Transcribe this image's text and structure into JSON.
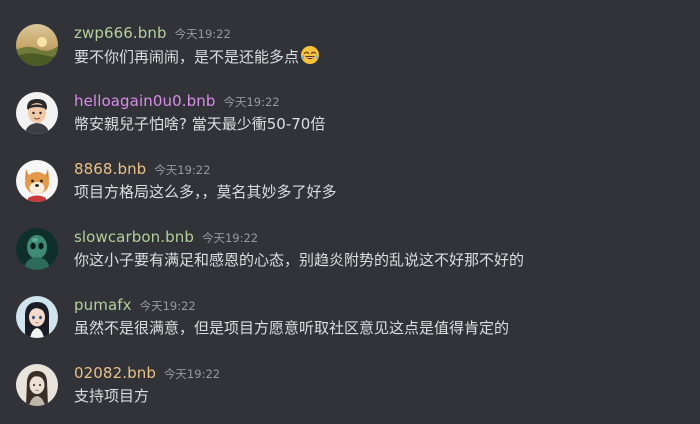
{
  "messages": [
    {
      "username": "zwp666.bnb",
      "name_color": "#b5cf9b",
      "timestamp": "今天19:22",
      "text": "要不你们再闹闹，是不是还能多点",
      "emoji": "face-with-tears-of-joy-icon",
      "avatar": "landscape-avatar"
    },
    {
      "username": "helloagain0u0.bnb",
      "name_color": "#d88ee8",
      "timestamp": "今天19:22",
      "text": "幣安親兒子怕啥? 當天最少衝50-70倍",
      "avatar": "cartoon-man-avatar"
    },
    {
      "username": "8868.bnb",
      "name_color": "#e8c188",
      "timestamp": "今天19:22",
      "text": "项目方格局这么多，，莫名其妙多了好多",
      "avatar": "shiba-dog-avatar"
    },
    {
      "username": "slowcarbon.bnb",
      "name_color": "#b5cf9b",
      "timestamp": "今天19:22",
      "text": "你这小子要有满足和感恩的心态，别趋炎附势的乱说这不好那不好的",
      "avatar": "green-alien-avatar"
    },
    {
      "username": "pumafx",
      "name_color": "#b5cf9b",
      "timestamp": "今天19:22",
      "text": "虽然不是很满意，但是项目方愿意听取社区意见这点是值得肯定的",
      "avatar": "anime-girl-avatar"
    },
    {
      "username": "02082.bnb",
      "name_color": "#e8c188",
      "timestamp": "今天19:22",
      "text": "支持项目方",
      "avatar": "sketch-portrait-avatar"
    }
  ]
}
